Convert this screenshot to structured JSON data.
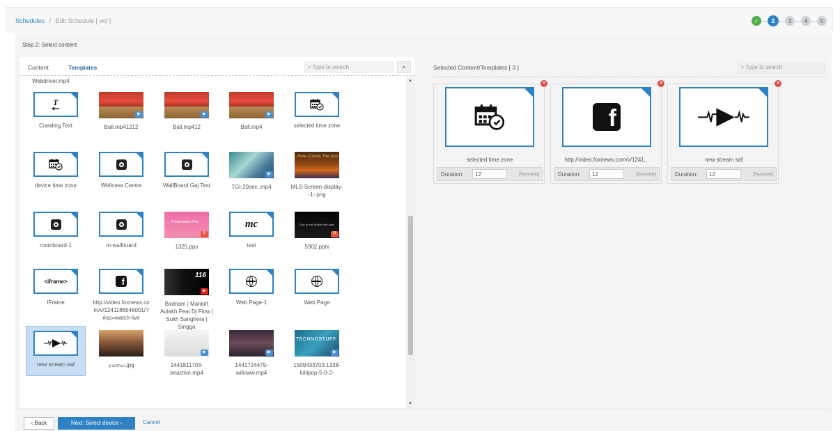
{
  "breadcrumb": {
    "root": "Schedules",
    "sep": "/",
    "current": "Edit Schedule  [ wd ]"
  },
  "steps": [
    {
      "label": "✓",
      "state": "done"
    },
    {
      "label": "2",
      "state": "current"
    },
    {
      "label": "3",
      "state": "pending"
    },
    {
      "label": "4",
      "state": "pending"
    },
    {
      "label": "5",
      "state": "pending"
    }
  ],
  "step_title": "Step 2: Select content",
  "left": {
    "tabs": [
      {
        "label": "Content"
      },
      {
        "label": "Templates"
      }
    ],
    "search_placeholder": "Type to search",
    "search_button_icon": "search-icon",
    "top_filename": "Webdriver.mp4",
    "items": [
      {
        "caption": "Crawling Text",
        "kind": "crawl"
      },
      {
        "caption": "Ball.mp41212",
        "kind": "photo-tomato",
        "badge": "video"
      },
      {
        "caption": "Ball.mp412",
        "kind": "photo-tomato",
        "badge": "video"
      },
      {
        "caption": "Ball.mp4",
        "kind": "photo-tomato",
        "badge": "video"
      },
      {
        "caption": "selected time zone",
        "kind": "calendar"
      },
      {
        "caption": "device time zone",
        "kind": "calendar"
      },
      {
        "caption": "Wellness Centre",
        "kind": "roomboard"
      },
      {
        "caption": "WallBoard Gaj Test",
        "kind": "roomboard"
      },
      {
        "caption": "TGI-29sec .mp4",
        "kind": "photo-tgi",
        "badge": "video"
      },
      {
        "caption": "MLS-Screen-display--1-.png",
        "kind": "photo-mls"
      },
      {
        "caption": "roomboard-1",
        "kind": "roomboard"
      },
      {
        "caption": "m-wallboard",
        "kind": "roomboard"
      },
      {
        "caption": "1325.pps",
        "kind": "photo-pps",
        "badge": "ppt"
      },
      {
        "caption": "test",
        "kind": "mc",
        "mark": "MC"
      },
      {
        "caption": "5902.pptx",
        "kind": "photo-pptx",
        "badge": "ppt"
      },
      {
        "caption": "IFrame",
        "kind": "iframe",
        "mark": "<iframe>"
      },
      {
        "caption": "http://video.foxnews.com/v/1241186546001/?#sp=watch-live",
        "kind": "facebook"
      },
      {
        "caption": "Badnam | Mankirt Aulakh Feat Dj Flow | Sukh Sanghera | Singga",
        "kind": "photo-badnam",
        "badge": "youtube"
      },
      {
        "caption": "Web Page-1",
        "kind": "globe"
      },
      {
        "caption": "Web Page",
        "kind": "globe"
      },
      {
        "caption": "new stream saf",
        "kind": "stream",
        "selected": true
      },
      {
        "caption": "நகலை.jpg",
        "kind": "photo-car"
      },
      {
        "caption": "1441811703-beactive.mp4",
        "kind": "photo-beactive",
        "badge": "video"
      },
      {
        "caption": "1441724479-willoww.mp4",
        "kind": "photo-willow",
        "badge": "video"
      },
      {
        "caption": "1509433703.1338-lollipop-5-0-2-",
        "kind": "photo-techno",
        "badge": "video"
      }
    ]
  },
  "right": {
    "title": "Selected Content/Templates [ 3 ]",
    "search_placeholder": "Type to search",
    "cards": [
      {
        "name": "selected time zone",
        "kind": "calendar",
        "duration_label": "Duration:",
        "duration": "12",
        "unit": "[Seconds]"
      },
      {
        "name": "http://video.foxnews.com/v/1241...",
        "kind": "facebook",
        "duration_label": "Duration:",
        "duration": "12",
        "unit": "[Seconds]"
      },
      {
        "name": "new stream saf",
        "kind": "stream",
        "duration_label": "Duration:",
        "duration": "12",
        "unit": "[Seconds]"
      }
    ]
  },
  "footer": {
    "back": "Back",
    "next": "Next: Select device",
    "cancel": "Cancel"
  },
  "colors": {
    "accent": "#2e82c4",
    "success": "#4cae4c",
    "danger": "#d9534f"
  }
}
